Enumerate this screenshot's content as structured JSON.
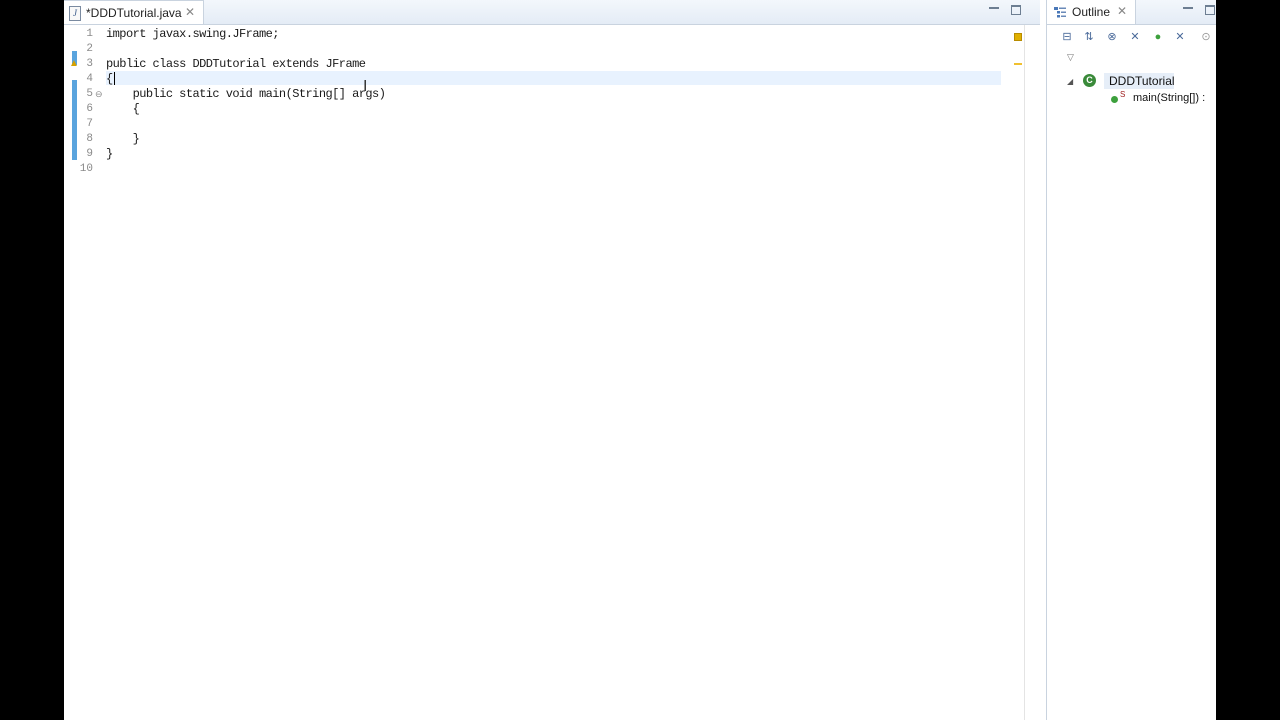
{
  "editor": {
    "tab_title": "*DDDTutorial.java",
    "tab_icon": "java-file-icon",
    "lines": [
      {
        "num": "1",
        "text": "import javax.swing.JFrame;"
      },
      {
        "num": "2",
        "text": ""
      },
      {
        "num": "3",
        "text": "public class DDDTutorial extends JFrame"
      },
      {
        "num": "4",
        "text": "{"
      },
      {
        "num": "5",
        "text": "    public static void main(String[] args)"
      },
      {
        "num": "6",
        "text": "    {"
      },
      {
        "num": "7",
        "text": ""
      },
      {
        "num": "8",
        "text": "    }"
      },
      {
        "num": "9",
        "text": "}"
      },
      {
        "num": "10",
        "text": ""
      }
    ],
    "fold_glyph": "⊖",
    "warning_icon": "warning-icon",
    "ibeam_glyph": "I"
  },
  "outline": {
    "title": "Outline",
    "class_name": "DDDTutorial",
    "class_icon_letter": "C",
    "method_label": "main(String[]) :",
    "static_marker": "S",
    "toolbar_icons": [
      "collapse-all-icon",
      "sort-icon",
      "hide-fields-icon",
      "hide-static-icon",
      "hide-nonpublic-icon",
      "hide-local-types-icon",
      "focus-icon"
    ]
  },
  "colors": {
    "change_bar": "#5aa4de",
    "current_line": "#e8f2fe",
    "class_icon": "#3a8a3a",
    "warning": "#e0b000"
  }
}
